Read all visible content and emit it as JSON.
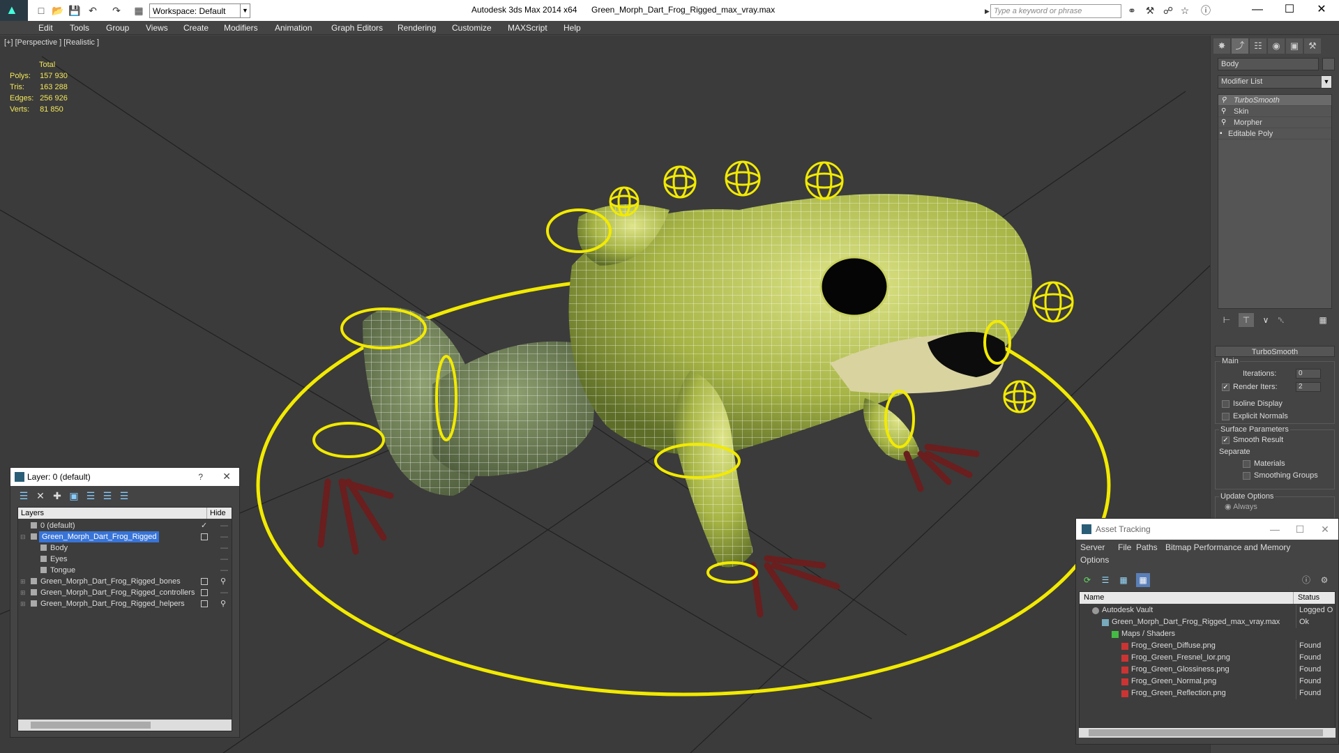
{
  "titlebar": {
    "workspace_label": "Workspace: Default",
    "app_title": "Autodesk 3ds Max  2014 x64",
    "file_title": "Green_Morph_Dart_Frog_Rigged_max_vray.max",
    "search_placeholder": "Type a keyword or phrase"
  },
  "menubar": {
    "items": [
      "Edit",
      "Tools",
      "Group",
      "Views",
      "Create",
      "Modifiers",
      "Animation",
      "Graph Editors",
      "Rendering",
      "Customize",
      "MAXScript",
      "Help"
    ]
  },
  "viewport": {
    "label": "[+] [Perspective ] [Realistic ]",
    "stats": {
      "header": "Total",
      "polys_label": "Polys:",
      "polys": "157 930",
      "tris_label": "Tris:",
      "tris": "163 288",
      "edges_label": "Edges:",
      "edges": "256 926",
      "verts_label": "Verts:",
      "verts": "81 850"
    }
  },
  "command_panel": {
    "object_name": "Body",
    "modifier_list": "Modifier List",
    "stack": [
      "TurboSmooth",
      "Skin",
      "Morpher",
      "Editable Poly"
    ],
    "turbosmooth": {
      "header": "TurboSmooth",
      "main": "Main",
      "iterations_label": "Iterations:",
      "iterations": "0",
      "render_iters_label": "Render Iters:",
      "render_iters": "2",
      "isoline": "Isoline Display",
      "explicit": "Explicit Normals",
      "surface_params": "Surface Parameters",
      "smooth_result": "Smooth Result",
      "separate": "Separate",
      "materials": "Materials",
      "smoothing_groups": "Smoothing Groups",
      "update_options": "Update Options",
      "always": "Always"
    }
  },
  "layer_window": {
    "title": "Layer: 0 (default)",
    "help": "?",
    "col_layers": "Layers",
    "col_hide": "Hide",
    "rows": [
      {
        "name": "0 (default)"
      },
      {
        "name": "Green_Morph_Dart_Frog_Rigged"
      },
      {
        "name": "Body"
      },
      {
        "name": "Eyes"
      },
      {
        "name": "Tongue"
      },
      {
        "name": "Green_Morph_Dart_Frog_Rigged_bones"
      },
      {
        "name": "Green_Morph_Dart_Frog_Rigged_controllers"
      },
      {
        "name": "Green_Morph_Dart_Frog_Rigged_helpers"
      }
    ]
  },
  "asset_window": {
    "title": "Asset Tracking",
    "menu": [
      "Server",
      "File",
      "Paths",
      "Bitmap Performance and Memory",
      "Options"
    ],
    "col_name": "Name",
    "col_status": "Status",
    "rows": [
      {
        "name": "Autodesk Vault",
        "status": "Logged O"
      },
      {
        "name": "Green_Morph_Dart_Frog_Rigged_max_vray.max",
        "status": "Ok"
      },
      {
        "name": "Maps / Shaders",
        "status": ""
      },
      {
        "name": "Frog_Green_Diffuse.png",
        "status": "Found"
      },
      {
        "name": "Frog_Green_Fresnel_Ior.png",
        "status": "Found"
      },
      {
        "name": "Frog_Green_Glossiness.png",
        "status": "Found"
      },
      {
        "name": "Frog_Green_Normal.png",
        "status": "Found"
      },
      {
        "name": "Frog_Green_Reflection.png",
        "status": "Found"
      }
    ]
  },
  "colors": {
    "viewport_bg": "#3b3b3b",
    "controller": "#f2ea00",
    "frog_body": "#a8b64a",
    "stats_text": "#f5e85a",
    "selection": "#3874d8"
  }
}
